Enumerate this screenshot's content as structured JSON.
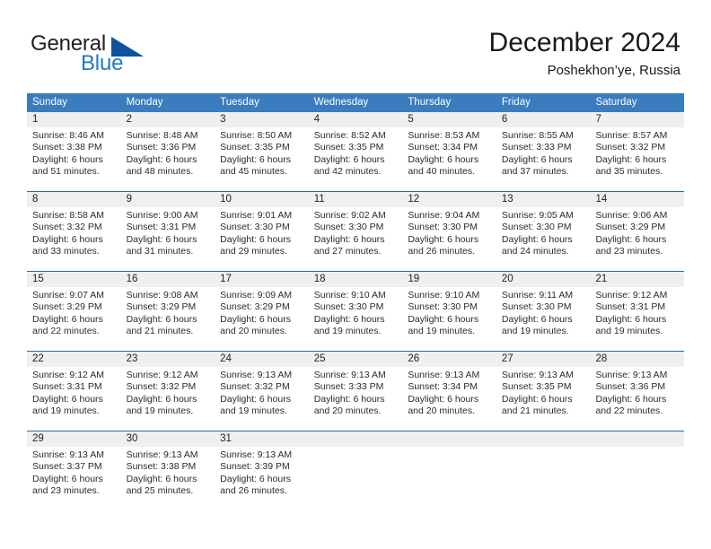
{
  "logo": {
    "text_top": "General",
    "text_bottom": "Blue",
    "triangle_color": "#10529e",
    "blue_color": "#1f7bc1"
  },
  "header": {
    "title": "December 2024",
    "subtitle": "Poshekhon’ye, Russia"
  },
  "theme": {
    "header_bg": "#3a7cbe",
    "row_divider": "#2c6aa8",
    "daynum_bg": "#efefef"
  },
  "weekdays": [
    "Sunday",
    "Monday",
    "Tuesday",
    "Wednesday",
    "Thursday",
    "Friday",
    "Saturday"
  ],
  "weeks": [
    [
      {
        "day": "1",
        "sunrise": "Sunrise: 8:46 AM",
        "sunset": "Sunset: 3:38 PM",
        "daylight_line1": "Daylight: 6 hours",
        "daylight_line2": "and 51 minutes."
      },
      {
        "day": "2",
        "sunrise": "Sunrise: 8:48 AM",
        "sunset": "Sunset: 3:36 PM",
        "daylight_line1": "Daylight: 6 hours",
        "daylight_line2": "and 48 minutes."
      },
      {
        "day": "3",
        "sunrise": "Sunrise: 8:50 AM",
        "sunset": "Sunset: 3:35 PM",
        "daylight_line1": "Daylight: 6 hours",
        "daylight_line2": "and 45 minutes."
      },
      {
        "day": "4",
        "sunrise": "Sunrise: 8:52 AM",
        "sunset": "Sunset: 3:35 PM",
        "daylight_line1": "Daylight: 6 hours",
        "daylight_line2": "and 42 minutes."
      },
      {
        "day": "5",
        "sunrise": "Sunrise: 8:53 AM",
        "sunset": "Sunset: 3:34 PM",
        "daylight_line1": "Daylight: 6 hours",
        "daylight_line2": "and 40 minutes."
      },
      {
        "day": "6",
        "sunrise": "Sunrise: 8:55 AM",
        "sunset": "Sunset: 3:33 PM",
        "daylight_line1": "Daylight: 6 hours",
        "daylight_line2": "and 37 minutes."
      },
      {
        "day": "7",
        "sunrise": "Sunrise: 8:57 AM",
        "sunset": "Sunset: 3:32 PM",
        "daylight_line1": "Daylight: 6 hours",
        "daylight_line2": "and 35 minutes."
      }
    ],
    [
      {
        "day": "8",
        "sunrise": "Sunrise: 8:58 AM",
        "sunset": "Sunset: 3:32 PM",
        "daylight_line1": "Daylight: 6 hours",
        "daylight_line2": "and 33 minutes."
      },
      {
        "day": "9",
        "sunrise": "Sunrise: 9:00 AM",
        "sunset": "Sunset: 3:31 PM",
        "daylight_line1": "Daylight: 6 hours",
        "daylight_line2": "and 31 minutes."
      },
      {
        "day": "10",
        "sunrise": "Sunrise: 9:01 AM",
        "sunset": "Sunset: 3:30 PM",
        "daylight_line1": "Daylight: 6 hours",
        "daylight_line2": "and 29 minutes."
      },
      {
        "day": "11",
        "sunrise": "Sunrise: 9:02 AM",
        "sunset": "Sunset: 3:30 PM",
        "daylight_line1": "Daylight: 6 hours",
        "daylight_line2": "and 27 minutes."
      },
      {
        "day": "12",
        "sunrise": "Sunrise: 9:04 AM",
        "sunset": "Sunset: 3:30 PM",
        "daylight_line1": "Daylight: 6 hours",
        "daylight_line2": "and 26 minutes."
      },
      {
        "day": "13",
        "sunrise": "Sunrise: 9:05 AM",
        "sunset": "Sunset: 3:30 PM",
        "daylight_line1": "Daylight: 6 hours",
        "daylight_line2": "and 24 minutes."
      },
      {
        "day": "14",
        "sunrise": "Sunrise: 9:06 AM",
        "sunset": "Sunset: 3:29 PM",
        "daylight_line1": "Daylight: 6 hours",
        "daylight_line2": "and 23 minutes."
      }
    ],
    [
      {
        "day": "15",
        "sunrise": "Sunrise: 9:07 AM",
        "sunset": "Sunset: 3:29 PM",
        "daylight_line1": "Daylight: 6 hours",
        "daylight_line2": "and 22 minutes."
      },
      {
        "day": "16",
        "sunrise": "Sunrise: 9:08 AM",
        "sunset": "Sunset: 3:29 PM",
        "daylight_line1": "Daylight: 6 hours",
        "daylight_line2": "and 21 minutes."
      },
      {
        "day": "17",
        "sunrise": "Sunrise: 9:09 AM",
        "sunset": "Sunset: 3:29 PM",
        "daylight_line1": "Daylight: 6 hours",
        "daylight_line2": "and 20 minutes."
      },
      {
        "day": "18",
        "sunrise": "Sunrise: 9:10 AM",
        "sunset": "Sunset: 3:30 PM",
        "daylight_line1": "Daylight: 6 hours",
        "daylight_line2": "and 19 minutes."
      },
      {
        "day": "19",
        "sunrise": "Sunrise: 9:10 AM",
        "sunset": "Sunset: 3:30 PM",
        "daylight_line1": "Daylight: 6 hours",
        "daylight_line2": "and 19 minutes."
      },
      {
        "day": "20",
        "sunrise": "Sunrise: 9:11 AM",
        "sunset": "Sunset: 3:30 PM",
        "daylight_line1": "Daylight: 6 hours",
        "daylight_line2": "and 19 minutes."
      },
      {
        "day": "21",
        "sunrise": "Sunrise: 9:12 AM",
        "sunset": "Sunset: 3:31 PM",
        "daylight_line1": "Daylight: 6 hours",
        "daylight_line2": "and 19 minutes."
      }
    ],
    [
      {
        "day": "22",
        "sunrise": "Sunrise: 9:12 AM",
        "sunset": "Sunset: 3:31 PM",
        "daylight_line1": "Daylight: 6 hours",
        "daylight_line2": "and 19 minutes."
      },
      {
        "day": "23",
        "sunrise": "Sunrise: 9:12 AM",
        "sunset": "Sunset: 3:32 PM",
        "daylight_line1": "Daylight: 6 hours",
        "daylight_line2": "and 19 minutes."
      },
      {
        "day": "24",
        "sunrise": "Sunrise: 9:13 AM",
        "sunset": "Sunset: 3:32 PM",
        "daylight_line1": "Daylight: 6 hours",
        "daylight_line2": "and 19 minutes."
      },
      {
        "day": "25",
        "sunrise": "Sunrise: 9:13 AM",
        "sunset": "Sunset: 3:33 PM",
        "daylight_line1": "Daylight: 6 hours",
        "daylight_line2": "and 20 minutes."
      },
      {
        "day": "26",
        "sunrise": "Sunrise: 9:13 AM",
        "sunset": "Sunset: 3:34 PM",
        "daylight_line1": "Daylight: 6 hours",
        "daylight_line2": "and 20 minutes."
      },
      {
        "day": "27",
        "sunrise": "Sunrise: 9:13 AM",
        "sunset": "Sunset: 3:35 PM",
        "daylight_line1": "Daylight: 6 hours",
        "daylight_line2": "and 21 minutes."
      },
      {
        "day": "28",
        "sunrise": "Sunrise: 9:13 AM",
        "sunset": "Sunset: 3:36 PM",
        "daylight_line1": "Daylight: 6 hours",
        "daylight_line2": "and 22 minutes."
      }
    ],
    [
      {
        "day": "29",
        "sunrise": "Sunrise: 9:13 AM",
        "sunset": "Sunset: 3:37 PM",
        "daylight_line1": "Daylight: 6 hours",
        "daylight_line2": "and 23 minutes."
      },
      {
        "day": "30",
        "sunrise": "Sunrise: 9:13 AM",
        "sunset": "Sunset: 3:38 PM",
        "daylight_line1": "Daylight: 6 hours",
        "daylight_line2": "and 25 minutes."
      },
      {
        "day": "31",
        "sunrise": "Sunrise: 9:13 AM",
        "sunset": "Sunset: 3:39 PM",
        "daylight_line1": "Daylight: 6 hours",
        "daylight_line2": "and 26 minutes."
      },
      {
        "day": "",
        "sunrise": "",
        "sunset": "",
        "daylight_line1": "",
        "daylight_line2": ""
      },
      {
        "day": "",
        "sunrise": "",
        "sunset": "",
        "daylight_line1": "",
        "daylight_line2": ""
      },
      {
        "day": "",
        "sunrise": "",
        "sunset": "",
        "daylight_line1": "",
        "daylight_line2": ""
      },
      {
        "day": "",
        "sunrise": "",
        "sunset": "",
        "daylight_line1": "",
        "daylight_line2": ""
      }
    ]
  ]
}
